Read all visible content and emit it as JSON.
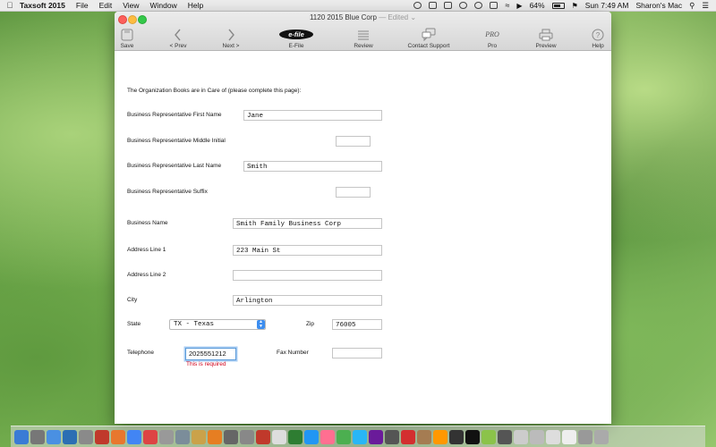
{
  "menubar": {
    "app_name": "Taxsoft 2015",
    "menus": [
      "File",
      "Edit",
      "View",
      "Window",
      "Help"
    ],
    "battery": "64%",
    "clock": "Sun 7:49 AM",
    "user": "Sharon's Mac"
  },
  "window": {
    "title": "1120 2015 Blue Corp",
    "title_status": "— Edited ⌄"
  },
  "toolbar": {
    "save": "Save",
    "prev": "< Prev",
    "next": "Next >",
    "efile": "E-File",
    "efile_logo": "e-file",
    "review": "Review",
    "support": "Contact Support",
    "pro": "Pro",
    "pro_logo": "PRO",
    "preview": "Preview",
    "help": "Help"
  },
  "form": {
    "intro": "The Organization Books are in Care of (please complete this page):",
    "first_name": {
      "label": "Business Representative First Name",
      "value": "Jane"
    },
    "middle_initial": {
      "label": "Business Representative Middle Initial",
      "value": ""
    },
    "last_name": {
      "label": "Business Representative Last Name",
      "value": "Smith"
    },
    "suffix": {
      "label": "Business Representative Suffix",
      "value": ""
    },
    "business_name": {
      "label": "Business Name",
      "value": "Smith Family Business Corp"
    },
    "address1": {
      "label": "Address Line 1",
      "value": "223 Main St"
    },
    "address2": {
      "label": "Address Line 2",
      "value": ""
    },
    "city": {
      "label": "City",
      "value": "Arlington"
    },
    "state": {
      "label": "State",
      "value": "TX - Texas"
    },
    "zip": {
      "label": "Zip",
      "value": "76005"
    },
    "telephone": {
      "label": "Telephone",
      "value": "2025551212",
      "error": "This is required"
    },
    "fax": {
      "label": "Fax Number",
      "value": ""
    }
  },
  "dock": {
    "icons": [
      "#3a7bd5",
      "#777",
      "#4a90e2",
      "#2c6fb3",
      "#8a8a8a",
      "#c0392b",
      "#e8772e",
      "#4285f4",
      "#d44",
      "#999",
      "#7b8d9a",
      "#caa24a",
      "#e67e22",
      "#666",
      "#888",
      "#c0392b",
      "#ddd",
      "#2e7d32",
      "#2196f3",
      "#ff6f91",
      "#4caf50",
      "#29b6f6",
      "#6a1b9a",
      "#555",
      "#d32f2f",
      "#a57c52",
      "#ff9800",
      "#333",
      "#111",
      "#8bc34a",
      "#555",
      "#ccc",
      "#bbb",
      "#ddd",
      "#eee",
      "#999",
      "#aaa"
    ]
  }
}
